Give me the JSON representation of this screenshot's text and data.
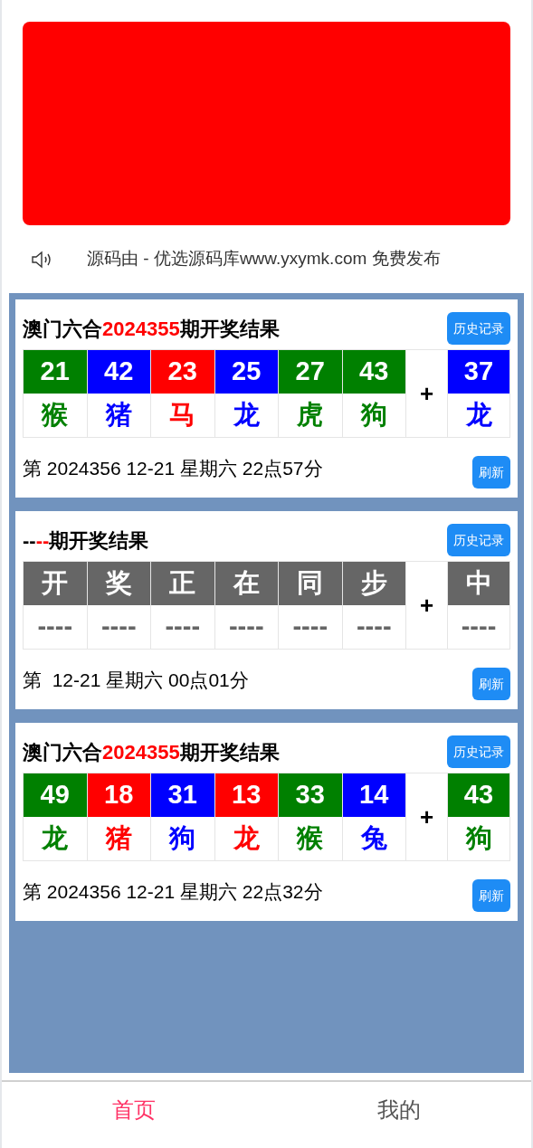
{
  "notice": {
    "text": "源码由 - 优选源码库www.yxymk.com 免费发布"
  },
  "cards": [
    {
      "title_prefix": "澳门六合",
      "issue": "2024355",
      "title_suffix": "期开奖结果",
      "history_button": "历史记录",
      "plus": "+",
      "next_draw": "第 2024356 12-21 星期六 22点57分",
      "refresh_button": "刷新",
      "balls": [
        {
          "number": "21",
          "zodiac": "猴",
          "color": "#008000"
        },
        {
          "number": "42",
          "zodiac": "猪",
          "color": "#0000ff"
        },
        {
          "number": "23",
          "zodiac": "马",
          "color": "#ff0000"
        },
        {
          "number": "25",
          "zodiac": "龙",
          "color": "#0000ff"
        },
        {
          "number": "27",
          "zodiac": "虎",
          "color": "#008000"
        },
        {
          "number": "43",
          "zodiac": "狗",
          "color": "#008000"
        },
        {
          "number": "37",
          "zodiac": "龙",
          "color": "#0000ff"
        }
      ]
    },
    {
      "title_prefix": "--",
      "issue": "--",
      "title_suffix": "期开奖结果",
      "history_button": "历史记录",
      "plus": "+",
      "next_draw": "第  12-21 星期六 00点01分",
      "refresh_button": "刷新",
      "balls": [
        {
          "number": "开",
          "zodiac": "----",
          "color": "#666666"
        },
        {
          "number": "奖",
          "zodiac": "----",
          "color": "#666666"
        },
        {
          "number": "正",
          "zodiac": "----",
          "color": "#666666"
        },
        {
          "number": "在",
          "zodiac": "----",
          "color": "#666666"
        },
        {
          "number": "同",
          "zodiac": "----",
          "color": "#666666"
        },
        {
          "number": "步",
          "zodiac": "----",
          "color": "#666666"
        },
        {
          "number": "中",
          "zodiac": "----",
          "color": "#666666"
        }
      ]
    },
    {
      "title_prefix": "澳门六合",
      "issue": "2024355",
      "title_suffix": "期开奖结果",
      "history_button": "历史记录",
      "plus": "+",
      "next_draw": "第 2024356 12-21 星期六 22点32分",
      "refresh_button": "刷新",
      "balls": [
        {
          "number": "49",
          "zodiac": "龙",
          "color": "#008000"
        },
        {
          "number": "18",
          "zodiac": "猪",
          "color": "#ff0000"
        },
        {
          "number": "31",
          "zodiac": "狗",
          "color": "#0000ff"
        },
        {
          "number": "13",
          "zodiac": "龙",
          "color": "#ff0000"
        },
        {
          "number": "33",
          "zodiac": "猴",
          "color": "#008000"
        },
        {
          "number": "14",
          "zodiac": "兔",
          "color": "#0000ff"
        },
        {
          "number": "43",
          "zodiac": "狗",
          "color": "#008000"
        }
      ]
    }
  ],
  "tab_bar": [
    {
      "label": "首页",
      "selected": true
    },
    {
      "label": "我的",
      "selected": false
    }
  ]
}
